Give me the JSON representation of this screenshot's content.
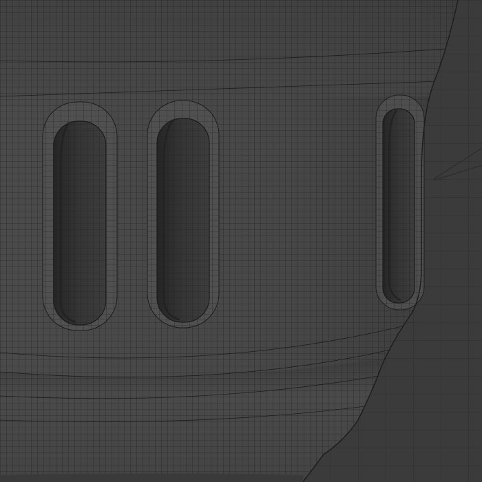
{
  "colors": {
    "background": "#3a3a3a",
    "surface": "#464646",
    "surface_light": "#505050",
    "surface_shadow": "#2e2e2e",
    "wire": "#1a1a1a",
    "slot_interior": "#323232",
    "slot_rim": "#5a5a5a"
  },
  "model": {
    "kind": "wireframe-shaded-mesh",
    "slot_count": 3
  }
}
